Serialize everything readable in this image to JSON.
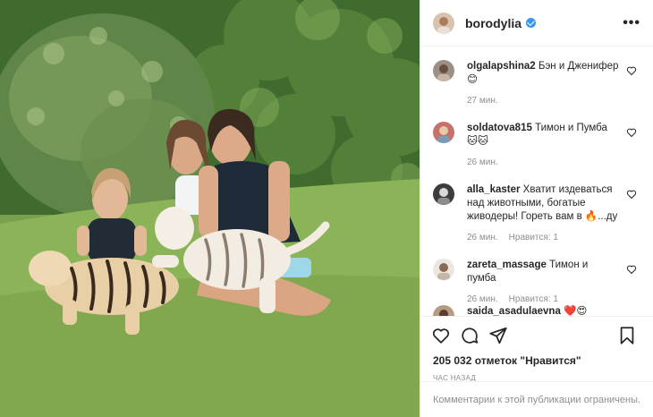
{
  "post": {
    "username": "borodylia",
    "verified": true,
    "more_label": "•••",
    "likes": "205 032 отметок \"Нравится\"",
    "time_ago": "ЧАС НАЗАД",
    "comments_disabled": "Комментарии к этой публикации ограничены."
  },
  "comments": [
    {
      "user": "olgalapshina2",
      "text": "Бэн и Дженифер",
      "emoji": "😊",
      "time": "27 мин.",
      "likes": ""
    },
    {
      "user": "soldatova815",
      "text": "Тимон и Пумба",
      "emoji": "🐱🐱",
      "time": "26 мин.",
      "likes": ""
    },
    {
      "user": "alla_kaster",
      "text": "Хватит издеваться над животными, богатые живодеры! Гореть вам в 🔥...ду",
      "emoji": "",
      "time": "26 мин.",
      "likes": "Нравится: 1"
    },
    {
      "user": "zareta_massage",
      "text": "Тимон и пумба",
      "emoji": "",
      "time": "26 мин.",
      "likes": "Нравится: 1"
    },
    {
      "user": "saida_asadulaevna",
      "text": "",
      "emoji": "❤️😍",
      "time": "",
      "likes": ""
    }
  ],
  "colors": {
    "verified": "#3897f0",
    "muted": "#8e8e8e",
    "text": "#262626",
    "border": "#efefef"
  },
  "icons": {
    "like": "heart-icon",
    "comment": "comment-icon",
    "share": "share-icon",
    "save": "bookmark-icon",
    "more": "more-icon"
  }
}
